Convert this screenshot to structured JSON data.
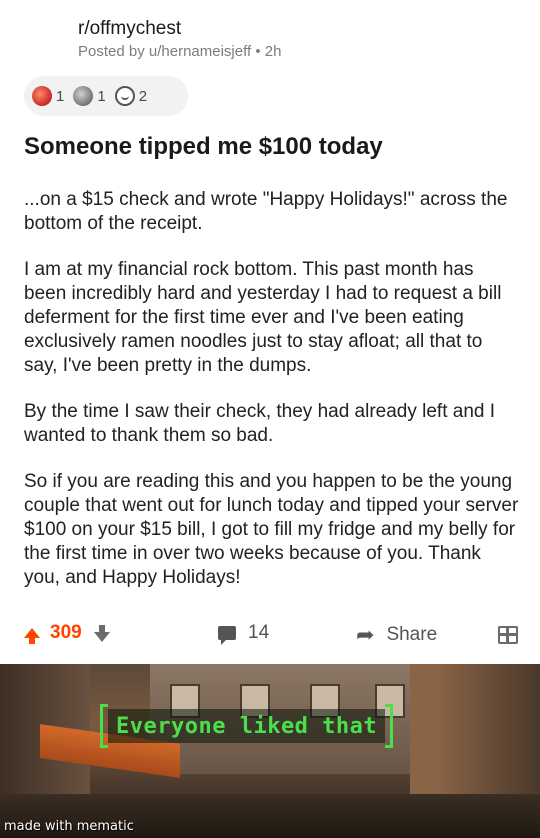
{
  "post": {
    "subreddit": "r/offmychest",
    "byline": "Posted by u/hernameisjeff • 2h",
    "awards": [
      {
        "icon": "award-red-icon",
        "count": "1"
      },
      {
        "icon": "award-silver-icon",
        "count": "1"
      },
      {
        "icon": "award-face-icon",
        "count": "2"
      }
    ],
    "title": "Someone tipped me $100 today",
    "paragraphs": [
      "...on a $15 check and wrote \"Happy Holidays!\" across the bottom of the receipt.",
      "I am at my financial rock bottom. This past month has been incredibly hard and yesterday I had to request a bill deferment for the first time ever and I've been eating exclusively ramen noodles just to stay afloat; all that to say, I've been pretty in the dumps.",
      "By the time I saw their check, they had already left and I wanted to thank them so bad.",
      "So if you are reading this and you happen to be the young couple that went out for lunch today and tipped your server $100 on your $15 bill, I got to fill my fridge and my belly for the first time in over two weeks because of you. Thank you, and Happy Holidays!"
    ]
  },
  "actions": {
    "score": "309",
    "comments": "14",
    "share": "Share",
    "colors": {
      "upvote": "#ff4500",
      "muted": "#6b6b6b"
    }
  },
  "meme": {
    "caption": "Everyone liked that",
    "watermark": "made with mematic",
    "caption_color": "#4be04b"
  }
}
